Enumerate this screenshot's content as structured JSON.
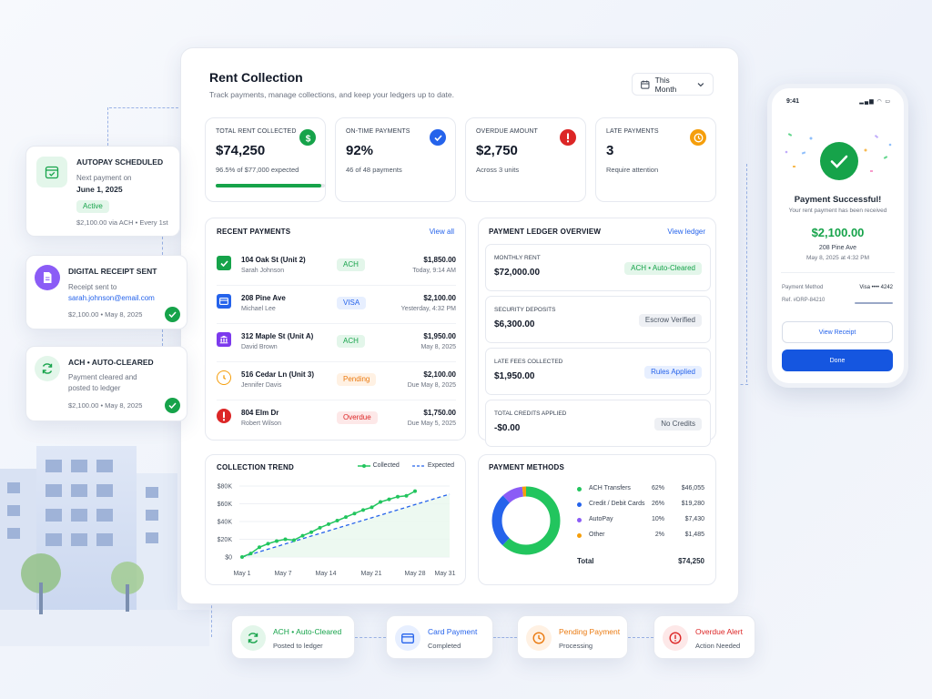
{
  "dashboard": {
    "title": "Rent Collection",
    "subtitle": "Track payments, manage collections, and keep your ledgers up to date.",
    "period": "This Month"
  },
  "stats": [
    {
      "label": "TOTAL RENT COLLECTED",
      "value": "$74,250",
      "sub": "96.5% of $77,000 expected",
      "progress": 96.5,
      "color": "#16a34a"
    },
    {
      "label": "ON-TIME PAYMENTS",
      "value": "92%",
      "sub": "46 of 48 payments",
      "color": "#2563eb"
    },
    {
      "label": "OVERDUE AMOUNT",
      "value": "$2,750",
      "sub": "Across 3 units",
      "color": "#dc2626"
    },
    {
      "label": "LATE PAYMENTS",
      "value": "3",
      "sub": "Require attention",
      "color": "#f59e0b"
    }
  ],
  "recent": {
    "title": "RECENT PAYMENTS",
    "link": "View all",
    "rows": [
      {
        "unit": "104 Oak St (Unit 2)",
        "name": "Sarah Johnson",
        "badge": "ACH",
        "amount": "$1,850.00",
        "date": "Today, 9:14 AM",
        "color": "#16a34a"
      },
      {
        "unit": "208 Pine Ave",
        "name": "Michael Lee",
        "badge": "VISA",
        "amount": "$2,100.00",
        "date": "Yesterday, 4:32 PM",
        "color": "#2563eb"
      },
      {
        "unit": "312 Maple St (Unit A)",
        "name": "David Brown",
        "badge": "ACH",
        "amount": "$1,950.00",
        "date": "May 8, 2025",
        "color": "#7c3aed"
      },
      {
        "unit": "516 Cedar Ln (Unit 3)",
        "name": "Jennifer Davis",
        "badge": "Pending",
        "amount": "$2,100.00",
        "date": "Due May 8, 2025",
        "color": "#f59e0b"
      },
      {
        "unit": "804 Elm Dr",
        "name": "Robert Wilson",
        "badge": "Overdue",
        "amount": "$1,750.00",
        "date": "Due May 5, 2025",
        "color": "#dc2626"
      }
    ]
  },
  "ledger": {
    "title": "PAYMENT LEDGER OVERVIEW",
    "link": "View ledger",
    "items": [
      {
        "label": "MONTHLY RENT",
        "value": "$72,000.00",
        "badge": "ACH • Auto-Cleared"
      },
      {
        "label": "SECURITY DEPOSITS",
        "value": "$6,300.00",
        "badge": "Escrow Verified"
      },
      {
        "label": "LATE FEES COLLECTED",
        "value": "$1,950.00",
        "badge": "Rules Applied"
      },
      {
        "label": "TOTAL CREDITS APPLIED",
        "value": "-$0.00",
        "badge": "No Credits"
      }
    ]
  },
  "trend": {
    "title": "COLLECTION TREND",
    "legend_collected": "Collected",
    "legend_expected": "Expected"
  },
  "chart_data": {
    "type": "line",
    "x": [
      "May 1",
      "May 7",
      "May 14",
      "May 21",
      "May 28",
      "May 31"
    ],
    "y_ticks": [
      "$0",
      "$20K",
      "$40K",
      "$60K",
      "$80K"
    ],
    "ylim": [
      0,
      80000
    ],
    "series": [
      {
        "name": "Collected",
        "values": [
          0,
          4000,
          11000,
          15000,
          18000,
          20000,
          19000,
          24000,
          28000,
          33000,
          37000,
          41000,
          45000,
          49000,
          53000,
          56000,
          62000,
          65000,
          68000,
          69000,
          74250
        ]
      },
      {
        "name": "Expected",
        "values": [
          0,
          77000
        ]
      }
    ]
  },
  "methods": {
    "title": "PAYMENT METHODS",
    "items": [
      {
        "name": "ACH Transfers",
        "pct": "62%",
        "amount": "$46,055",
        "color": "#22c55e",
        "share": 62
      },
      {
        "name": "Credit / Debit Cards",
        "pct": "26%",
        "amount": "$19,280",
        "color": "#2563eb",
        "share": 26
      },
      {
        "name": "AutoPay",
        "pct": "10%",
        "amount": "$7,430",
        "color": "#8b5cf6",
        "share": 10
      },
      {
        "name": "Other",
        "pct": "2%",
        "amount": "$1,485",
        "color": "#f59e0b",
        "share": 2
      }
    ],
    "total_label": "Total",
    "total_value": "$74,250"
  },
  "floats": {
    "autopay": {
      "title": "AUTOPAY SCHEDULED",
      "line1": "Next payment on",
      "line2": "June 1, 2025",
      "badge": "Active",
      "foot": "$2,100.00 via ACH • Every 1st"
    },
    "receipt": {
      "title": "DIGITAL RECEIPT SENT",
      "line1": "Receipt sent to",
      "email": "sarah.johnson@email.com",
      "foot": "$2,100.00 • May 8, 2025"
    },
    "ach": {
      "title": "ACH • AUTO-CLEARED",
      "line1": "Payment cleared and",
      "line2": "posted to ledger",
      "foot": "$2,100.00 • May 8, 2025"
    }
  },
  "phone": {
    "time": "9:41",
    "title": "Payment Successful!",
    "sub": "Your rent payment has been received",
    "amount": "$2,100.00",
    "address": "208 Pine Ave",
    "date": "May 8, 2025 at 4:32 PM",
    "method_label": "Payment Method",
    "method_value": "Visa •••• 4242",
    "ref": "Ref. #DRP-84210",
    "btn_view": "View Receipt",
    "btn_done": "Done"
  },
  "flow": [
    {
      "title": "ACH • Auto-Cleared",
      "sub": "Posted to ledger",
      "color": "#16a34a"
    },
    {
      "title": "Card Payment",
      "sub": "Completed",
      "color": "#2563eb"
    },
    {
      "title": "Pending Payment",
      "sub": "Processing",
      "color": "#ea7a10"
    },
    {
      "title": "Overdue Alert",
      "sub": "Action Needed",
      "color": "#dc2626"
    }
  ]
}
